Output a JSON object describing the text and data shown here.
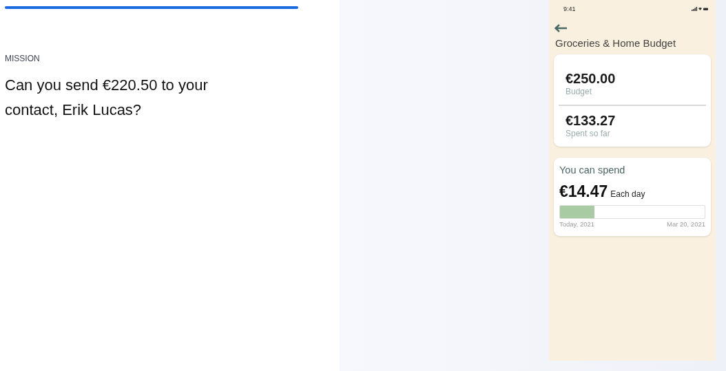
{
  "progress": {
    "level": 1
  },
  "mission": {
    "label": "MISSION",
    "question": "Can you send €220.50 to your contact, Erik Lucas?"
  },
  "phone": {
    "status_time": "9:41",
    "title": "Groceries & Home Budget",
    "summary": [
      {
        "amount": "€250.00",
        "label": "Budget"
      },
      {
        "amount": "€133.27",
        "label": "Spent so far"
      }
    ],
    "spend": {
      "heading": "You can spend",
      "amount": "€14.47",
      "unit": "Each day",
      "level": 0.24,
      "start": "Today, 2021",
      "end": "Mar 20, 2021"
    }
  }
}
